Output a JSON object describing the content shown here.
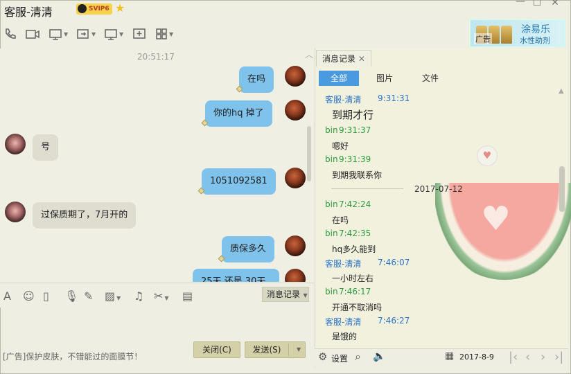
{
  "window": {
    "title": "客服-清清",
    "vip_badge": "SVIP6",
    "controls": [
      "minimize-icon",
      "maximize-icon",
      "close-icon"
    ]
  },
  "toolbar": {
    "icons": [
      "phone-icon",
      "video-icon",
      "screen-share-icon",
      "transfer-icon",
      "remote-desktop-icon",
      "add-icon",
      "apps-icon"
    ]
  },
  "ad_banner": {
    "tag": "广告",
    "line1": "涂易乐",
    "line2": "水性助剂"
  },
  "chat": {
    "timestamp": "20:51:17",
    "messages": [
      {
        "side": "right",
        "text": "在吗"
      },
      {
        "side": "right",
        "text": "你的hq  掉了"
      },
      {
        "side": "left",
        "text": "号"
      },
      {
        "side": "right",
        "text": "1051092581"
      },
      {
        "side": "left",
        "text": "过保质期了，7月开的"
      },
      {
        "side": "right",
        "text": "质保多久"
      },
      {
        "side": "right",
        "text": "25天  还是 30天"
      }
    ]
  },
  "input_toolbar": {
    "icons": [
      "font-icon",
      "emoji-icon",
      "vibrate-icon",
      "voice-icon",
      "pen-icon",
      "image-icon",
      "music-icon",
      "scissors-icon",
      "clipboard-icon"
    ],
    "history_button": "消息记录"
  },
  "footer": {
    "ad_text": "[广告]保护皮肤，不错能过的面膜节！",
    "close_button": "关闭(C)",
    "send_button": "发送(S)"
  },
  "history_panel": {
    "tab_title": "消息记录",
    "filters": [
      "全部",
      "图片",
      "文件"
    ],
    "active_filter": "全部",
    "entries": [
      {
        "name": "客服-清清",
        "time": "9:31:31",
        "text": "到期才行"
      },
      {
        "name": "bin",
        "time": "9:31:37",
        "text": "嗯好"
      },
      {
        "name": "bin",
        "time": "9:31:39",
        "text": "到期我联系你"
      },
      {
        "name": "bin",
        "time": "7:42:24",
        "text": "在吗"
      },
      {
        "name": "bin",
        "time": "7:42:35",
        "text": "hq多久能到"
      },
      {
        "name": "客服-清清",
        "time": "7:46:07",
        "text": "一小时左右"
      },
      {
        "name": "bin",
        "time": "7:46:17",
        "text": "开通不取消吗"
      },
      {
        "name": "客服-清清",
        "time": "7:46:27",
        "text": "是饿的"
      }
    ],
    "date_divider": "2017-07-12",
    "settings_label": "设置",
    "current_date": "2017-8-9"
  },
  "colors": {
    "bubble_self": "#7fc2ec",
    "bubble_other": "#deddcf",
    "active_filter_bg": "#4a9ae0",
    "name_self": "#2a9a3a",
    "name_other": "#2a72c4"
  }
}
